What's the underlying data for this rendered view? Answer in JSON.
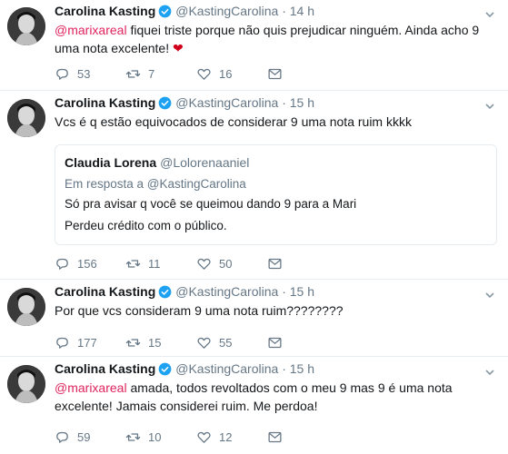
{
  "colors": {
    "mention": "#e0245e",
    "verified": "#1da1f2",
    "muted": "#657786",
    "heart_emoji": "#d0021b"
  },
  "tweets": [
    {
      "name": "Carolina Kasting",
      "handle": "@KastingCarolina",
      "separator": "·",
      "time": "14 h",
      "mention": "@marixareal",
      "text_line1_rest": " fiquei triste porque não quis prejudicar ninguém. Ainda acho 9",
      "text_line2": "uma nota excelente! ",
      "emoji": "❤",
      "replies": "53",
      "retweets": "7",
      "likes": "16"
    },
    {
      "name": "Carolina Kasting",
      "handle": "@KastingCarolina",
      "separator": "·",
      "time": "15 h",
      "text_line1": "Vcs é q estão equivocados de considerar 9 uma nota ruim kkkk",
      "quote": {
        "name": "Claudia Lorena",
        "handle": "@Lolorenaaniel",
        "reply_to": "Em resposta a @KastingCarolina",
        "line1": "Só pra avisar q você se queimou dando 9 para a Mari",
        "line2": "Perdeu crédito com o público."
      },
      "replies": "156",
      "retweets": "11",
      "likes": "50"
    },
    {
      "name": "Carolina Kasting",
      "handle": "@KastingCarolina",
      "separator": "·",
      "time": "15 h",
      "text_line1": "Por que vcs consideram 9 uma nota ruim????????",
      "replies": "177",
      "retweets": "15",
      "likes": "55"
    },
    {
      "name": "Carolina Kasting",
      "handle": "@KastingCarolina",
      "separator": "·",
      "time": "15 h",
      "mention": "@marixareal",
      "text_line1_rest": " amada, todos revoltados com o meu 9 mas 9 é uma nota",
      "text_line2": "excelente! Jamais considerei ruim. Me perdoa!",
      "replies": "59",
      "retweets": "10",
      "likes": "12"
    }
  ]
}
